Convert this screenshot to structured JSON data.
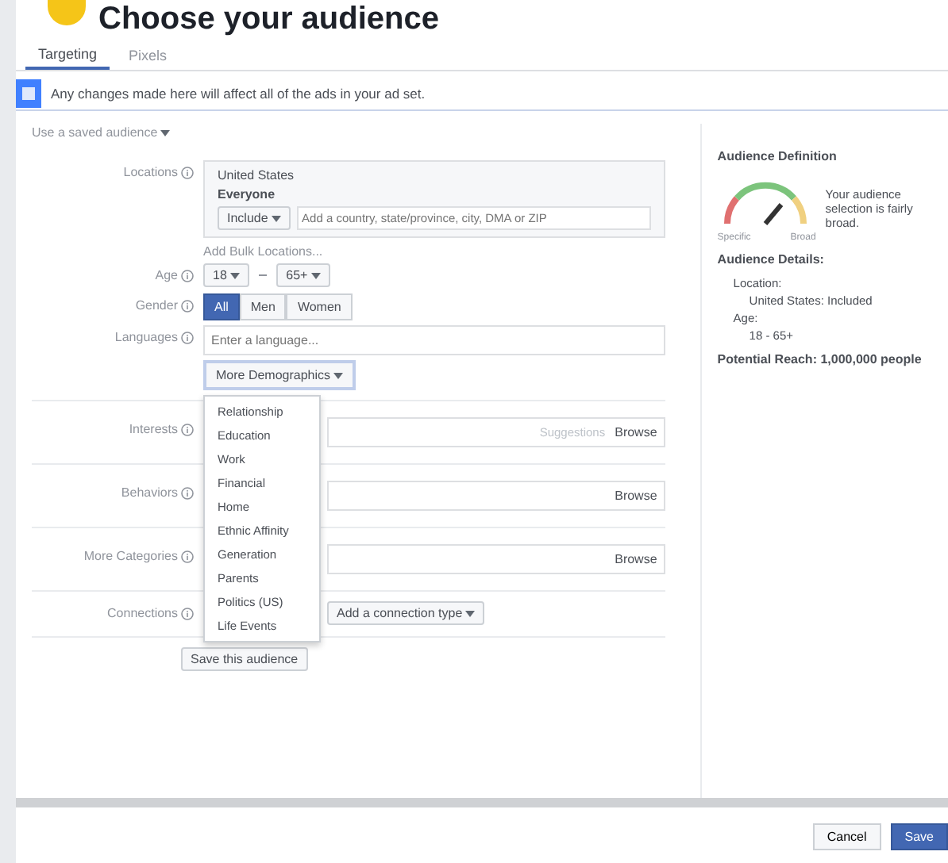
{
  "heading": "Choose your audience",
  "tabs": [
    {
      "label": "Targeting",
      "selected": true
    },
    {
      "label": "Pixels",
      "selected": false
    }
  ],
  "notice": "Any changes made here will affect all of the ads in your ad set.",
  "saved_audience": "Use a saved audience",
  "form": {
    "locations": {
      "label": "Locations",
      "country": "United States",
      "scope": "Everyone",
      "include": "Include",
      "placeholder": "Add a country, state/province, city, DMA or ZIP",
      "bulk_link": "Add Bulk Locations..."
    },
    "age": {
      "label": "Age",
      "min": "18",
      "max": "65+"
    },
    "gender": {
      "label": "Gender",
      "options": [
        {
          "label": "All",
          "selected": true
        },
        {
          "label": "Men",
          "selected": false
        },
        {
          "label": "Women",
          "selected": false
        }
      ]
    },
    "languages": {
      "label": "Languages",
      "placeholder": "Enter a language..."
    },
    "more_demographics": "More Demographics",
    "menu": [
      {
        "label": "Relationship"
      },
      {
        "label": "Education"
      },
      {
        "label": "Work"
      },
      {
        "label": "Financial"
      },
      {
        "label": "Home"
      },
      {
        "label": "Ethnic Affinity"
      },
      {
        "label": "Generation"
      },
      {
        "label": "Parents"
      },
      {
        "label": "Politics (US)"
      },
      {
        "label": "Life Events"
      }
    ],
    "rows": [
      {
        "label": "Interests",
        "hint": "Suggestions",
        "action": "Browse"
      },
      {
        "label": "Behaviors",
        "action": "Browse"
      },
      {
        "label": "More Categories",
        "action": "Browse"
      }
    ],
    "connections": {
      "label": "Connections",
      "value": "Add a connection type"
    },
    "save_audience": "Save this audience"
  },
  "definition": {
    "title": "Audience Definition",
    "specific": "Specific",
    "broad": "Broad",
    "summary": "Your audience selection is fairly broad.",
    "details_title": "Audience Details:",
    "details": [
      {
        "label": "Location:",
        "value": "United States: Included"
      },
      {
        "label": "Age:",
        "value": "18 - 65+"
      }
    ],
    "reach": "Potential Reach: 1,000,000 people"
  },
  "footer": {
    "cancel": "Cancel",
    "save": "Save"
  }
}
